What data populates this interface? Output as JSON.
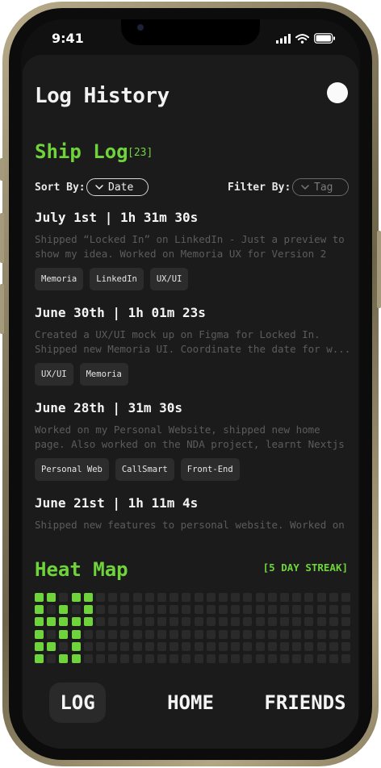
{
  "status_bar": {
    "time": "9:41"
  },
  "header": {
    "title": "Log History"
  },
  "ship_log": {
    "title": "Ship Log",
    "count": "[23]",
    "sort_label": "Sort By:",
    "sort_value": "Date",
    "filter_label": "Filter By:",
    "filter_placeholder": "Tag"
  },
  "entries": [
    {
      "heading": "July 1st | 1h 31m 30s",
      "description": "Shipped “Locked In” on LinkedIn - Just a preview to show my idea. Worked on Memoria UX for Version 2 pi...",
      "tags": [
        "Memoria",
        "LinkedIn",
        "UX/UI"
      ]
    },
    {
      "heading": "June 30th | 1h 01m 23s",
      "description": "Created a UX/UI mock up on Figma for Locked In. Shipped new Memoria UI. Coordinate the date for w...",
      "tags": [
        "UX/UI",
        "Memoria"
      ]
    },
    {
      "heading": "June 28th | 31m 30s",
      "description": "Worked on my Personal Website, shipped new home page. Also worked on the NDA project, learnt Nextjs",
      "tags": [
        "Personal Web",
        "CallSmart",
        "Front-End"
      ]
    },
    {
      "heading": "June 21st | 1h 11m 4s",
      "description": "Shipped new features to personal website. Worked on",
      "tags": []
    }
  ],
  "heat_map": {
    "title": "Heat Map",
    "streak": "[5 DAY STREAK]",
    "active_color": "#6fd43b",
    "inactive_color": "#2a2a2a",
    "columns": 26,
    "rows": 6,
    "active_cells": [
      [
        0,
        0
      ],
      [
        0,
        1
      ],
      [
        0,
        2
      ],
      [
        0,
        3
      ],
      [
        0,
        4
      ],
      [
        0,
        5
      ],
      [
        1,
        0
      ],
      [
        1,
        2
      ],
      [
        1,
        4
      ],
      [
        2,
        1
      ],
      [
        2,
        2
      ],
      [
        2,
        3
      ],
      [
        2,
        5
      ],
      [
        3,
        0
      ],
      [
        3,
        2
      ],
      [
        3,
        3
      ],
      [
        3,
        4
      ],
      [
        3,
        5
      ],
      [
        4,
        0
      ],
      [
        4,
        1
      ],
      [
        4,
        2
      ]
    ]
  },
  "nav": {
    "items": [
      {
        "label": "LOG",
        "active": true
      },
      {
        "label": "HOME",
        "active": false
      },
      {
        "label": "FRIENDS",
        "active": false
      }
    ]
  }
}
